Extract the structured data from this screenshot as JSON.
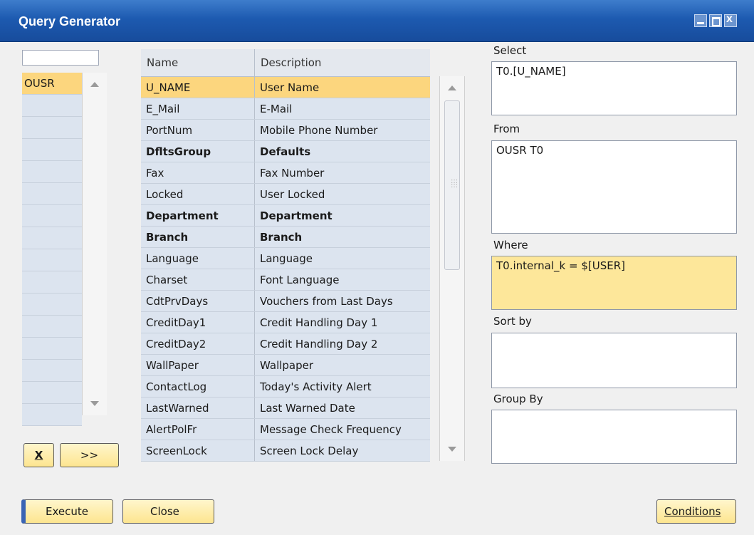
{
  "window": {
    "title": "Query Generator"
  },
  "tables": {
    "items": [
      "OUSR",
      "",
      "",
      "",
      "",
      "",
      "",
      "",
      "",
      "",
      "",
      "",
      "",
      "",
      "",
      ""
    ],
    "remove_label": "X",
    "add_label": ">>"
  },
  "fields": {
    "headers": {
      "name": "Name",
      "description": "Description"
    },
    "rows": [
      {
        "name": "U_NAME",
        "description": "User Name",
        "selected": true,
        "bold": false
      },
      {
        "name": "E_Mail",
        "description": "E-Mail",
        "selected": false,
        "bold": false
      },
      {
        "name": "PortNum",
        "description": "Mobile Phone Number",
        "selected": false,
        "bold": false
      },
      {
        "name": "DfltsGroup",
        "description": "Defaults",
        "selected": false,
        "bold": true
      },
      {
        "name": "Fax",
        "description": "Fax Number",
        "selected": false,
        "bold": false
      },
      {
        "name": "Locked",
        "description": "User Locked",
        "selected": false,
        "bold": false
      },
      {
        "name": "Department",
        "description": "Department",
        "selected": false,
        "bold": true
      },
      {
        "name": "Branch",
        "description": "Branch",
        "selected": false,
        "bold": true
      },
      {
        "name": "Language",
        "description": "Language",
        "selected": false,
        "bold": false
      },
      {
        "name": "Charset",
        "description": "Font Language",
        "selected": false,
        "bold": false
      },
      {
        "name": "CdtPrvDays",
        "description": "Vouchers from Last Days",
        "selected": false,
        "bold": false
      },
      {
        "name": "CreditDay1",
        "description": "Credit Handling Day 1",
        "selected": false,
        "bold": false
      },
      {
        "name": "CreditDay2",
        "description": "Credit Handling Day 2",
        "selected": false,
        "bold": false
      },
      {
        "name": "WallPaper",
        "description": "Wallpaper",
        "selected": false,
        "bold": false
      },
      {
        "name": "ContactLog",
        "description": "Today's Activity Alert",
        "selected": false,
        "bold": false
      },
      {
        "name": "LastWarned",
        "description": "Last Warned Date",
        "selected": false,
        "bold": false
      },
      {
        "name": "AlertPolFr",
        "description": "Message Check Frequency",
        "selected": false,
        "bold": false
      },
      {
        "name": "ScreenLock",
        "description": "Screen Lock Delay",
        "selected": false,
        "bold": false
      }
    ]
  },
  "query": {
    "select_label": "Select",
    "select_value": "T0.[U_NAME]",
    "from_label": "From",
    "from_value": "OUSR T0",
    "where_label": "Where",
    "where_value": "T0.internal_k = $[USER]",
    "sort_label": "Sort by",
    "sort_value": "",
    "group_label": "Group By",
    "group_value": ""
  },
  "footer": {
    "execute_label": "Execute",
    "close_label": "Close",
    "conditions_label": "Conditions"
  },
  "colors": {
    "titlebar": "#1d5ab0",
    "selected_row": "#fcd67e",
    "row": "#dce4ef",
    "where_box": "#fde79a"
  }
}
